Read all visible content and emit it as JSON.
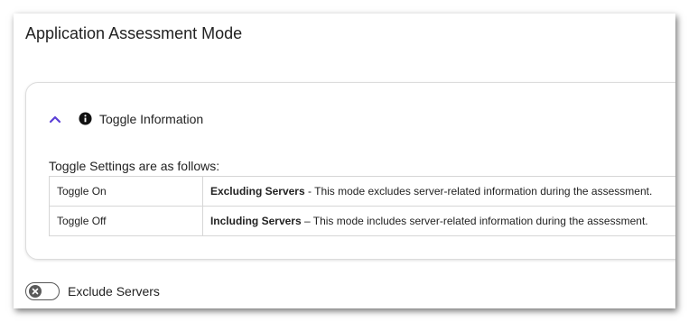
{
  "page": {
    "title": "Application Assessment Mode"
  },
  "info_card": {
    "title": "Toggle Information",
    "intro": "Toggle Settings are as follows:",
    "rows": [
      {
        "setting": "Toggle On",
        "mode": "Excluding Servers",
        "separator": " - ",
        "description": "This mode excludes server-related information during the assessment."
      },
      {
        "setting": "Toggle Off",
        "mode": "Including Servers",
        "separator": " – ",
        "description": "This mode includes server-related information during the assessment."
      }
    ]
  },
  "toggle": {
    "label": "Exclude Servers",
    "state": "off"
  },
  "icons": {
    "collapse": "chevron-up-icon",
    "info": "info-icon",
    "toggle_knob": "close-icon"
  },
  "colors": {
    "accent": "#5b3fd6",
    "toggle_border": "#555555",
    "toggle_knob": "#5a5a5a"
  }
}
